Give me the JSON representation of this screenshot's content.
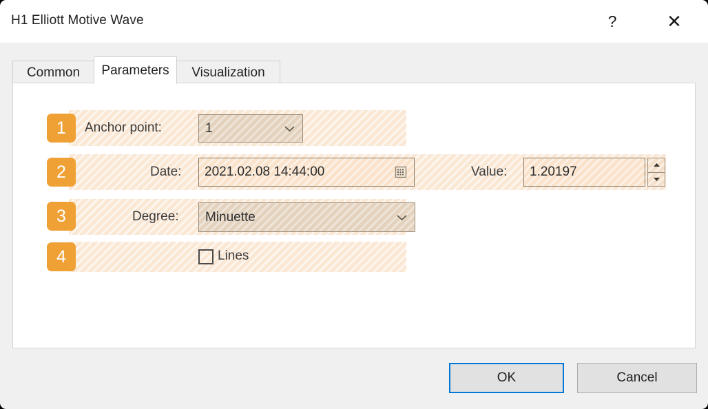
{
  "window": {
    "title": "H1 Elliott Motive Wave",
    "help_glyph": "?",
    "close_glyph": "✕"
  },
  "tabs": [
    {
      "id": "common",
      "label": "Common",
      "selected": false
    },
    {
      "id": "parameters",
      "label": "Parameters",
      "selected": true
    },
    {
      "id": "visualization",
      "label": "Visualization",
      "selected": false
    }
  ],
  "parameters": {
    "rows": [
      {
        "badge": "1",
        "label": "Anchor point:",
        "control": "combobox",
        "value": "1"
      },
      {
        "badge": "2",
        "label": "Date:",
        "control": "datetime",
        "value": "2021.02.08 14:44:00",
        "secondary_label": "Value:",
        "secondary_value": "1.20197"
      },
      {
        "badge": "3",
        "label": "Degree:",
        "control": "combobox",
        "value": "Minuette"
      },
      {
        "badge": "4",
        "label": "Lines",
        "control": "checkbox",
        "checked": false
      }
    ]
  },
  "buttons": {
    "ok": "OK",
    "cancel": "Cancel"
  },
  "colors": {
    "badge_orange": "#efa135",
    "focus_blue": "#0078d7",
    "row_highlight": "#fae7d4",
    "dialog_bg": "#f0f0f0",
    "panel_bg": "#ffffff"
  }
}
